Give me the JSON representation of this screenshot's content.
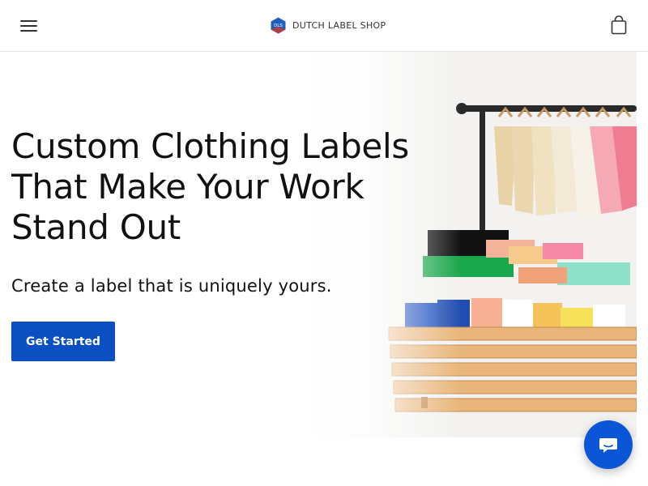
{
  "header": {
    "brand_name": "DUTCH LABEL SHOP",
    "logo_badge": "DLS"
  },
  "hero": {
    "title": "Custom Clothing Labels That Make Your Work Stand Out",
    "subtitle": "Create a label that is uniquely yours.",
    "cta_label": "Get Started"
  },
  "icons": {
    "menu": "hamburger-menu-icon",
    "cart": "shopping-bag-icon",
    "chat": "chat-bubble-icon",
    "logo": "hexagon-logo-icon"
  },
  "colors": {
    "primary": "#0b4fc1",
    "chat": "#0b56d6",
    "logo_blue": "#1f5fb8",
    "text": "#111111"
  }
}
